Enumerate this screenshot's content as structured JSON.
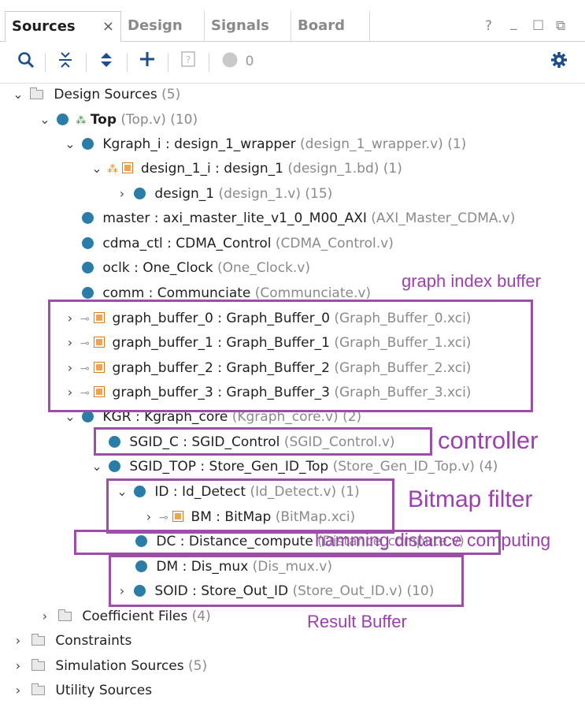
{
  "tabs": [
    {
      "label": "Sources",
      "active": true
    },
    {
      "label": "Design",
      "active": false
    },
    {
      "label": "Signals",
      "active": false
    },
    {
      "label": "Board",
      "active": false
    }
  ],
  "tab_close": "×",
  "window_controls": {
    "help": "?",
    "minimize": "_",
    "maximize": "☐",
    "float": "⧉"
  },
  "toolbar": {
    "message_count": "0"
  },
  "tree": {
    "design_sources": {
      "label": "Design Sources",
      "count": "(5)"
    },
    "top": {
      "label": "Top",
      "file": "(Top.v)",
      "count": "(10)"
    },
    "kgraph_i": {
      "label": "Kgraph_i : design_1_wrapper",
      "file": "(design_1_wrapper.v)",
      "count": "(1)"
    },
    "design_1_i": {
      "label": "design_1_i : design_1",
      "file": "(design_1.bd)",
      "count": "(1)"
    },
    "design_1": {
      "label": "design_1",
      "file": "(design_1.v)",
      "count": "(15)"
    },
    "master": {
      "label": "master : axi_master_lite_v1_0_M00_AXI",
      "file": "(AXI_Master_CDMA.v)"
    },
    "cdma_ctl": {
      "label": "cdma_ctl : CDMA_Control",
      "file": "(CDMA_Control.v)"
    },
    "oclk": {
      "label": "oclk : One_Clock",
      "file": "(One_Clock.v)"
    },
    "comm": {
      "label": "comm : Communciate",
      "file": "(Communciate.v)"
    },
    "gb0": {
      "label": "graph_buffer_0 : Graph_Buffer_0",
      "file": "(Graph_Buffer_0.xci)"
    },
    "gb1": {
      "label": "graph_buffer_1 : Graph_Buffer_1",
      "file": "(Graph_Buffer_1.xci)"
    },
    "gb2": {
      "label": "graph_buffer_2 : Graph_Buffer_2",
      "file": "(Graph_Buffer_2.xci)"
    },
    "gb3": {
      "label": "graph_buffer_3 : Graph_Buffer_3",
      "file": "(Graph_Buffer_3.xci)"
    },
    "kgr": {
      "label": "KGR : Kgraph_core",
      "file": "(Kgraph_core.v)",
      "count": "(2)"
    },
    "sgid_c": {
      "label": "SGID_C : SGID_Control",
      "file": "(SGID_Control.v)"
    },
    "sgid_top": {
      "label": "SGID_TOP : Store_Gen_ID_Top",
      "file": "(Store_Gen_ID_Top.v)",
      "count": "(4)"
    },
    "id": {
      "label": "ID : Id_Detect",
      "file": "(Id_Detect.v)",
      "count": "(1)"
    },
    "bm": {
      "label": "BM : BitMap",
      "file": "(BitMap.xci)"
    },
    "dc": {
      "label": "DC : Distance_compute",
      "file": "(Distance_compute.v)"
    },
    "dm": {
      "label": "DM : Dis_mux",
      "file": "(Dis_mux.v)"
    },
    "soid": {
      "label": "SOID : Store_Out_ID",
      "file": "(Store_Out_ID.v)",
      "count": "(10)"
    },
    "coeff": {
      "label": "Coefficient Files",
      "count": "(4)"
    },
    "constraints": {
      "label": "Constraints"
    },
    "sim": {
      "label": "Simulation Sources",
      "count": "(5)"
    },
    "util": {
      "label": "Utility Sources"
    }
  },
  "annotations": {
    "graph_index_buffer": "graph index buffer",
    "controller": "controller",
    "bitmap_filter": "Bitmap filter",
    "hamming": "hamming distance computing",
    "result_buffer": "Result Buffer"
  },
  "colors": {
    "annotation": "#9d3fb0",
    "module_dot": "#2b7da8",
    "ip_icon": "#f4a24c",
    "toolbar_icon": "#1d4e8c"
  }
}
